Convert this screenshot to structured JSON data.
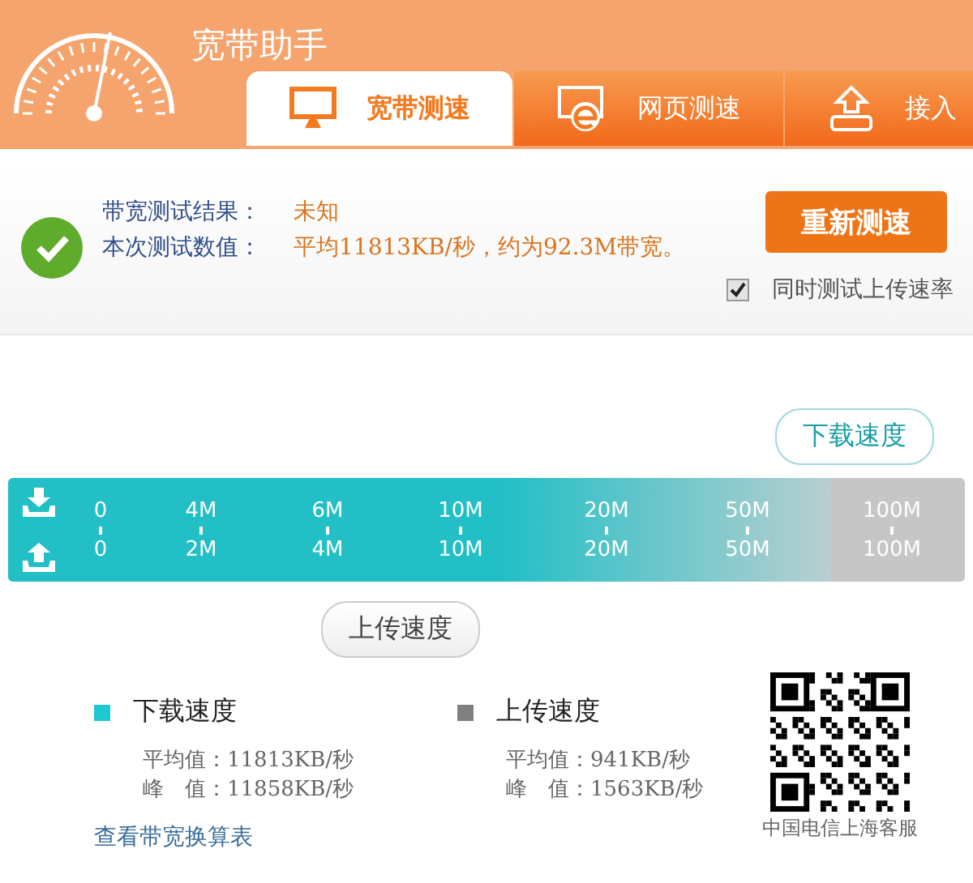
{
  "app": {
    "title": "宽带助手"
  },
  "tabs": [
    {
      "label": "宽带测速",
      "kind": "monitor",
      "selected": true
    },
    {
      "label": "网页测速",
      "kind": "browser",
      "selected": false
    },
    {
      "label": "接入",
      "kind": "router",
      "selected": false
    }
  ],
  "result": {
    "passed": true,
    "lines": [
      {
        "label": "带宽测试结果：",
        "value": "未知"
      },
      {
        "label": "本次测试数值：",
        "value": "平均11813KB/秒，约为92.3M带宽。"
      }
    ],
    "retest_button": "重新测速",
    "upload_test": {
      "label": "同时测试上传速率",
      "checked": true
    }
  },
  "meter": {
    "level": 0.86,
    "scale": [
      {
        "down": "0",
        "up": "0"
      },
      {
        "down": "4M",
        "up": "2M"
      },
      {
        "down": "6M",
        "up": "4M"
      },
      {
        "down": "10M",
        "up": "10M"
      },
      {
        "down": "20M",
        "up": "20M"
      },
      {
        "down": "50M",
        "up": "50M"
      },
      {
        "down": "100M",
        "up": "100M"
      }
    ],
    "download_marker": {
      "label": "下载速度",
      "level": 0.885
    },
    "upload_marker": {
      "label": "上传速度",
      "level": 0.41
    }
  },
  "legend": [
    {
      "name": "下载速度",
      "color": "#1fc8d0",
      "stats": [
        "平均值：11813KB/秒",
        "峰　值：11858KB/秒"
      ]
    },
    {
      "name": "上传速度",
      "color": "#808080",
      "stats": [
        "平均值：941KB/秒",
        "峰　值：1563KB/秒"
      ]
    }
  ],
  "conversion_link": "查看带宽换算表",
  "qr_caption": "中国电信上海客服"
}
